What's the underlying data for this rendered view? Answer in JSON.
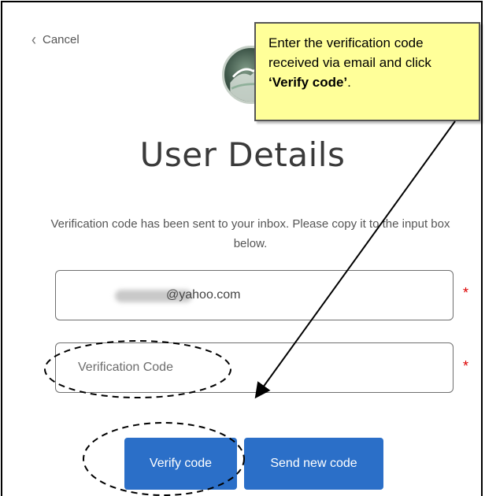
{
  "nav": {
    "cancel_label": "Cancel"
  },
  "header": {
    "title": "User Details"
  },
  "message": "Verification code has been sent to your inbox. Please copy it to the input box below.",
  "email_field": {
    "value_suffix": "@yahoo.com",
    "required_mark": "*"
  },
  "code_field": {
    "placeholder": "Verification Code",
    "required_mark": "*"
  },
  "buttons": {
    "verify_label": "Verify code",
    "send_label": "Send new code"
  },
  "callout": {
    "text_before": "Enter the verification code received via email and click ",
    "text_bold": "‘Verify code’",
    "text_after": "."
  },
  "colors": {
    "primary_button": "#2b6fc8",
    "callout_bg": "#ffff99",
    "required": "#dd0000"
  },
  "icons": [
    "chevron-left-icon",
    "org-logo"
  ]
}
